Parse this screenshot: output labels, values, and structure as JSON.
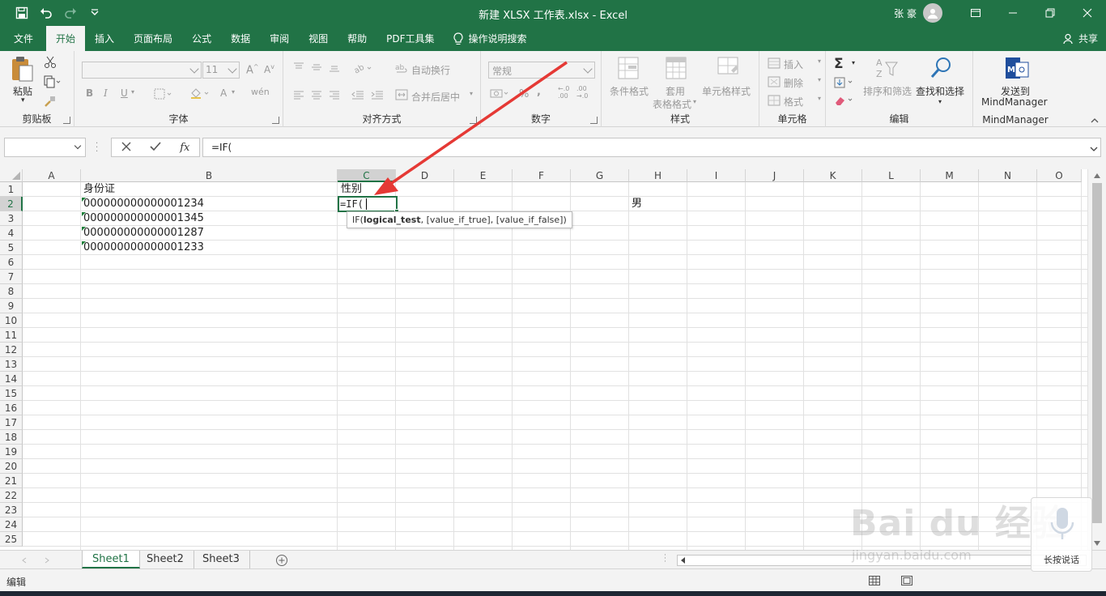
{
  "window": {
    "title": "新建 XLSX 工作表.xlsx  -  Excel",
    "user": "张 豪"
  },
  "tabs": [
    {
      "label": "文件"
    },
    {
      "label": "开始",
      "active": true
    },
    {
      "label": "插入"
    },
    {
      "label": "页面布局"
    },
    {
      "label": "公式"
    },
    {
      "label": "数据"
    },
    {
      "label": "审阅"
    },
    {
      "label": "视图"
    },
    {
      "label": "帮助"
    },
    {
      "label": "PDF工具集"
    }
  ],
  "tellme": "操作说明搜索",
  "share": "共享",
  "ribbon": {
    "clipboard": {
      "label": "剪贴板",
      "paste": "粘贴"
    },
    "font": {
      "label": "字体",
      "size": "11"
    },
    "alignment": {
      "label": "对齐方式",
      "wrap": "自动换行",
      "merge": "合并后居中"
    },
    "number": {
      "label": "数字",
      "format": "常规"
    },
    "styles": {
      "label": "样式",
      "conditional": "条件格式",
      "table_line1": "套用",
      "table_line2": "表格格式",
      "cell_styles": "单元格样式"
    },
    "cells": {
      "label": "单元格",
      "insert": "插入",
      "delete": "删除",
      "format": "格式"
    },
    "editing": {
      "label": "编辑",
      "sort": "排序和筛选",
      "find": "查找和选择"
    },
    "mindmanager": {
      "label": "MindManager",
      "send_line1": "发送到",
      "send_line2": "MindManager"
    }
  },
  "formula_bar": {
    "name_box": "",
    "formula": "=IF("
  },
  "columns": [
    "A",
    "B",
    "C",
    "D",
    "E",
    "F",
    "G",
    "H",
    "I",
    "J",
    "K",
    "L",
    "M",
    "N",
    "O"
  ],
  "rows": [
    "1",
    "2",
    "3",
    "4",
    "5",
    "6",
    "7",
    "8",
    "9",
    "10",
    "11",
    "12",
    "13",
    "14",
    "15",
    "16",
    "17",
    "18",
    "19",
    "20",
    "21",
    "22",
    "23",
    "24",
    "25"
  ],
  "cells": {
    "B1": "身份证",
    "B2": "000000000000001234",
    "B3": "000000000000001345",
    "B4": "000000000000001287",
    "B5": "000000000000001233",
    "C1": "性别",
    "C2": "=IF(",
    "H2": "男"
  },
  "tooltip": {
    "func": "IF(",
    "arg1": "logical_test",
    "rest": ", [value_if_true], [value_if_false])"
  },
  "sheets": [
    {
      "name": "Sheet1",
      "active": true
    },
    {
      "name": "Sheet2"
    },
    {
      "name": "Sheet3"
    }
  ],
  "status": {
    "mode": "编辑"
  },
  "watermark": {
    "brand": "Bai du 经验",
    "url": "jingyan.baidu.com",
    "voice": "长按说话"
  },
  "colors": {
    "accent": "#217346",
    "arrow": "#e53935"
  }
}
